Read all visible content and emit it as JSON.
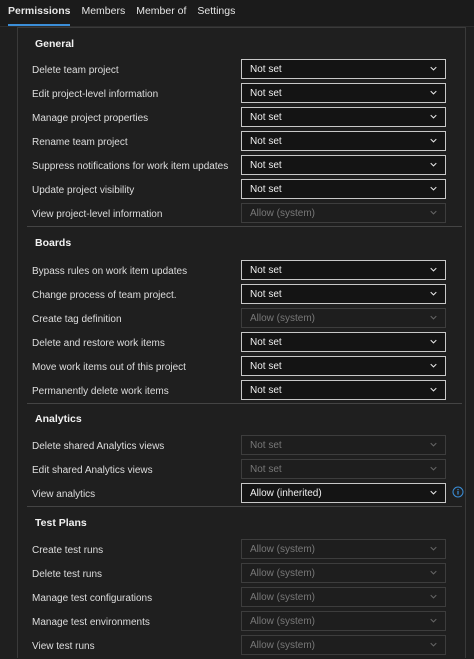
{
  "tabs": [
    "Permissions",
    "Members",
    "Member of",
    "Settings"
  ],
  "sections": [
    {
      "title": "General",
      "rows": [
        {
          "label": "Delete team project",
          "value": "Not set",
          "disabled": false
        },
        {
          "label": "Edit project-level information",
          "value": "Not set",
          "disabled": false
        },
        {
          "label": "Manage project properties",
          "value": "Not set",
          "disabled": false
        },
        {
          "label": "Rename team project",
          "value": "Not set",
          "disabled": false
        },
        {
          "label": "Suppress notifications for work item updates",
          "value": "Not set",
          "disabled": false
        },
        {
          "label": "Update project visibility",
          "value": "Not set",
          "disabled": false
        },
        {
          "label": "View project-level information",
          "value": "Allow (system)",
          "disabled": true
        }
      ]
    },
    {
      "title": "Boards",
      "rows": [
        {
          "label": "Bypass rules on work item updates",
          "value": "Not set",
          "disabled": false
        },
        {
          "label": "Change process of team project.",
          "value": "Not set",
          "disabled": false
        },
        {
          "label": "Create tag definition",
          "value": "Allow (system)",
          "disabled": true
        },
        {
          "label": "Delete and restore work items",
          "value": "Not set",
          "disabled": false
        },
        {
          "label": "Move work items out of this project",
          "value": "Not set",
          "disabled": false
        },
        {
          "label": "Permanently delete work items",
          "value": "Not set",
          "disabled": false
        }
      ]
    },
    {
      "title": "Analytics",
      "rows": [
        {
          "label": "Delete shared Analytics views",
          "value": "Not set",
          "disabled": true
        },
        {
          "label": "Edit shared Analytics views",
          "value": "Not set",
          "disabled": true
        },
        {
          "label": "View analytics",
          "value": "Allow (inherited)",
          "disabled": false,
          "info": true
        }
      ]
    },
    {
      "title": "Test Plans",
      "rows": [
        {
          "label": "Create test runs",
          "value": "Allow (system)",
          "disabled": true
        },
        {
          "label": "Delete test runs",
          "value": "Allow (system)",
          "disabled": true
        },
        {
          "label": "Manage test configurations",
          "value": "Allow (system)",
          "disabled": true
        },
        {
          "label": "Manage test environments",
          "value": "Allow (system)",
          "disabled": true
        },
        {
          "label": "View test runs",
          "value": "Allow (system)",
          "disabled": true
        }
      ]
    }
  ],
  "icons": {
    "dropdown": "chevron-down-icon",
    "info": "info-icon"
  },
  "colors": {
    "accent": "#3b8ed8",
    "background": "#1f1f1f"
  }
}
